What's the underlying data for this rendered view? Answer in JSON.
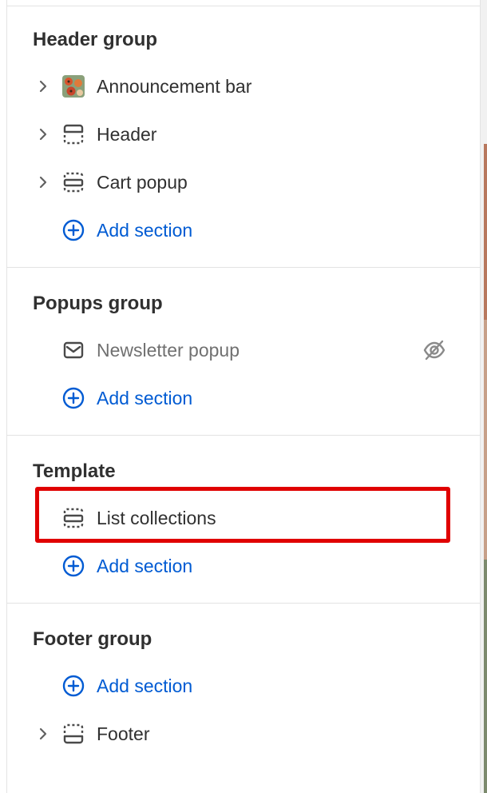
{
  "groups": {
    "header": {
      "title": "Header group",
      "items": [
        "Announcement bar",
        "Header",
        "Cart popup"
      ],
      "add_label": "Add section"
    },
    "popups": {
      "title": "Popups group",
      "items": [
        "Newsletter popup"
      ],
      "add_label": "Add section"
    },
    "template": {
      "title": "Template",
      "items": [
        "List collections"
      ],
      "add_label": "Add section"
    },
    "footer": {
      "title": "Footer group",
      "add_label": "Add section",
      "items": [
        "Footer"
      ]
    }
  },
  "icons": {
    "chevron": "chevron-right-icon",
    "announcement": "image-thumbnail-icon",
    "header": "header-layout-icon",
    "section": "section-layout-icon",
    "mail": "mail-icon",
    "hidden": "eye-off-icon",
    "add": "plus-circle-icon",
    "footer": "footer-layout-icon"
  },
  "colors": {
    "accent": "#005bd3",
    "text": "#303030",
    "muted": "#707070",
    "highlight": "#e00000"
  }
}
